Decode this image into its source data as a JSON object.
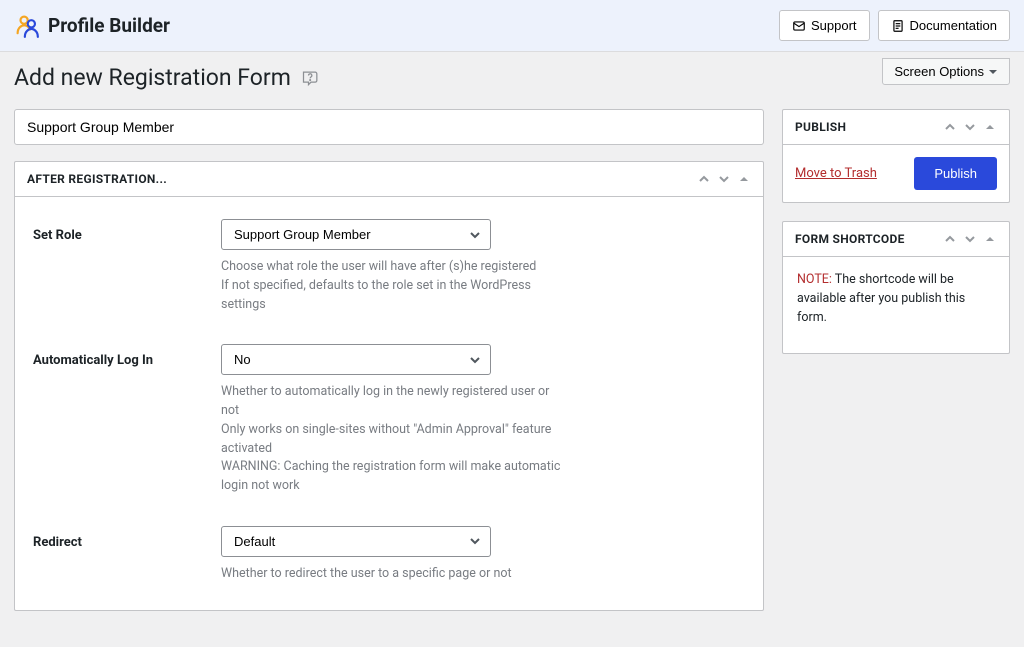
{
  "header": {
    "brand": "Profile Builder",
    "support": "Support",
    "documentation": "Documentation"
  },
  "page": {
    "title": "Add new Registration Form",
    "screen_options": "Screen Options"
  },
  "post": {
    "title_value": "Support Group Member"
  },
  "metabox": {
    "title": "After Registration...",
    "set_role": {
      "label": "Set Role",
      "value": "Support Group Member",
      "desc_a": "Choose what role the user will have after (s)he registered",
      "desc_b": "If not specified, defaults to the role set in the WordPress settings"
    },
    "auto_login": {
      "label": "Automatically Log In",
      "value": "No",
      "desc_a": "Whether to automatically log in the newly registered user or not",
      "desc_b": "Only works on single-sites without \"Admin Approval\" feature activated",
      "desc_c": "WARNING: Caching the registration form will make automatic login not work"
    },
    "redirect": {
      "label": "Redirect",
      "value": "Default",
      "desc": "Whether to redirect the user to a specific page or not"
    }
  },
  "publish": {
    "title": "Publish",
    "trash": "Move to Trash",
    "button": "Publish"
  },
  "shortcode": {
    "title": "Form Shortcode",
    "note_label": "NOTE:",
    "note_text": " The shortcode will be available after you publish this form."
  }
}
